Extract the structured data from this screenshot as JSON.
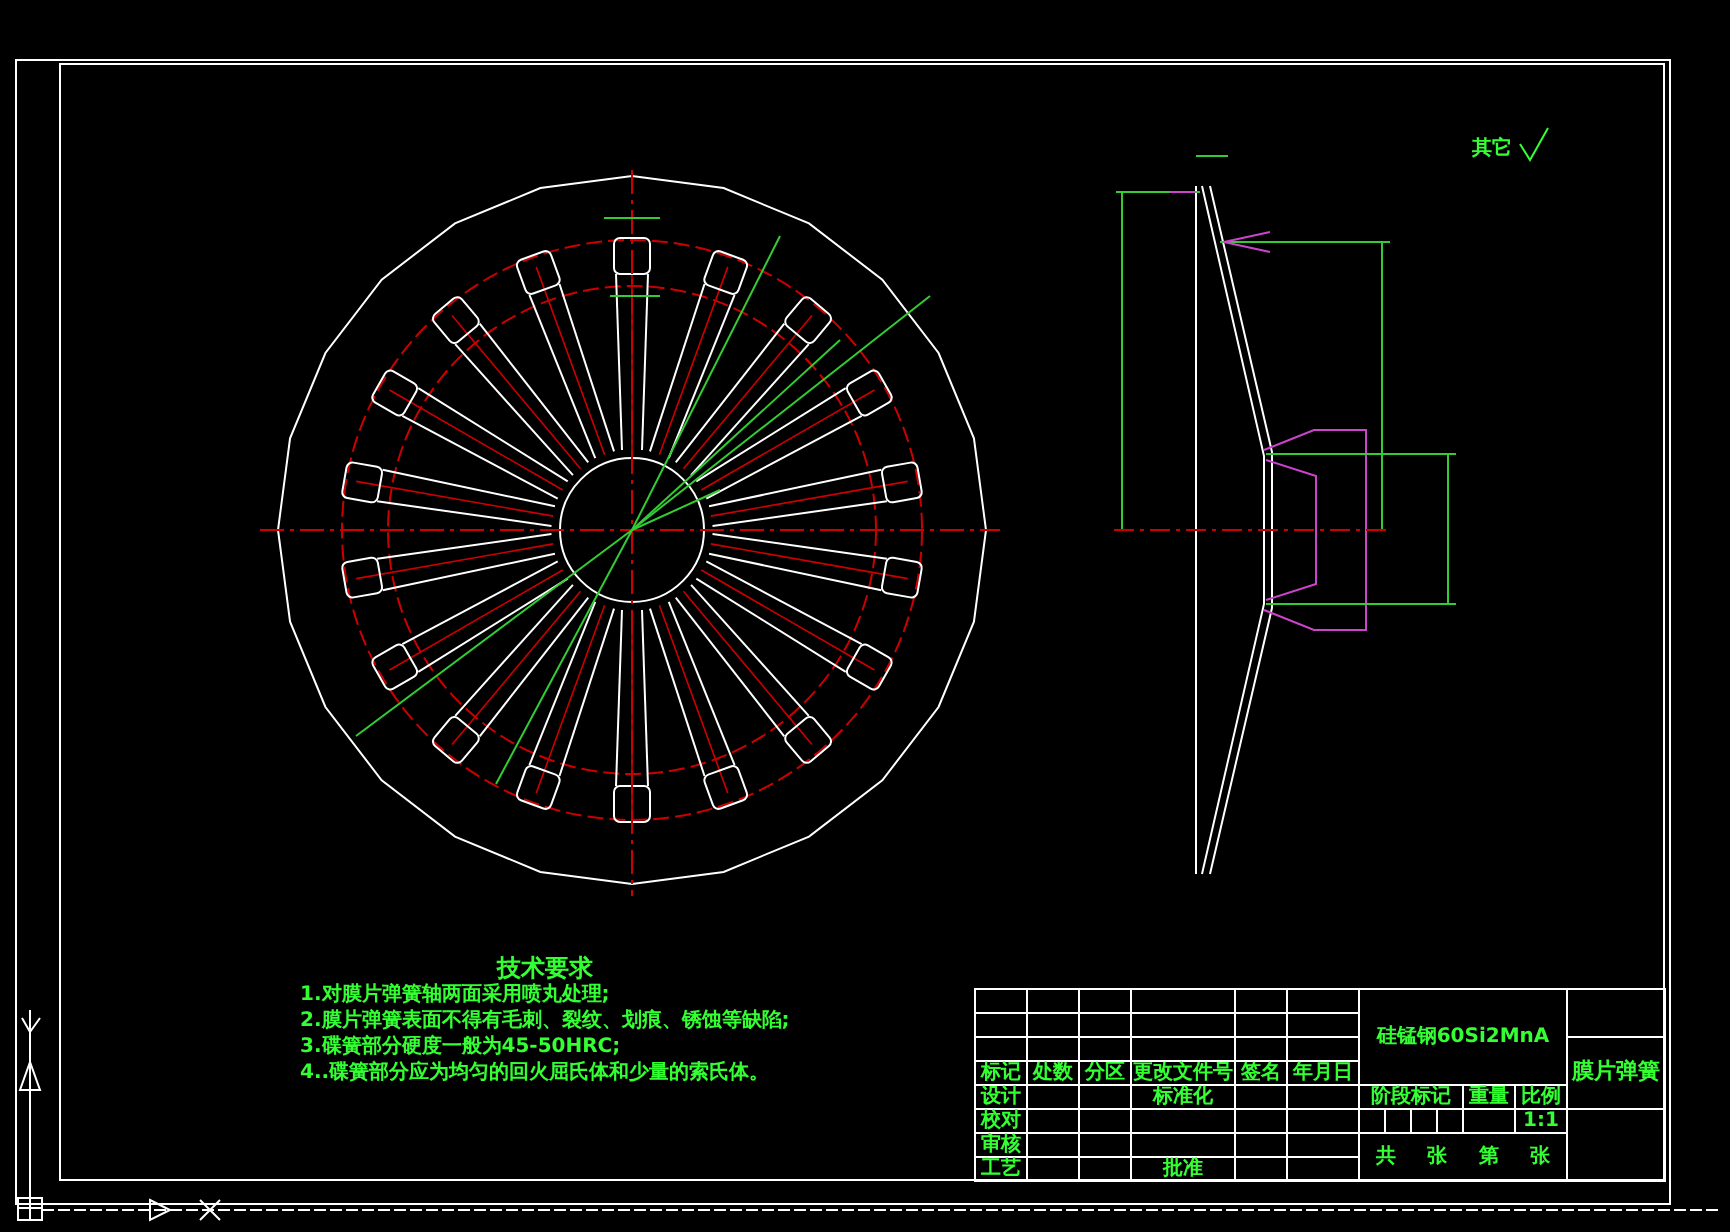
{
  "requirements": {
    "title": "技术要求",
    "items": [
      "1.对膜片弹簧轴两面采用喷丸处理;",
      "2.膜片弹簧表面不得有毛刺、裂纹、划痕、锈蚀等缺陷;",
      "3.碟簧部分硬度一般为45-50HRC;",
      "4..碟簧部分应为均匀的回火屈氏体和少量的索氏体。"
    ]
  },
  "roughness_note": "其它",
  "title_block": {
    "header_labels": [
      "标记",
      "处数",
      "分区",
      "更改文件号",
      "签名",
      "年月日"
    ],
    "rows": [
      {
        "label": "设计",
        "note": "标准化"
      },
      {
        "label": "校对"
      },
      {
        "label": "审核"
      },
      {
        "label": "工艺",
        "note": "批准"
      }
    ],
    "material": "硅锰钢60Si2MnA",
    "stage_labels": [
      "阶段标记",
      "重量",
      "比例"
    ],
    "scale": "1:1",
    "sheet_labels": [
      "共",
      "张",
      "第",
      "张"
    ],
    "part_name": "膜片弹簧"
  }
}
